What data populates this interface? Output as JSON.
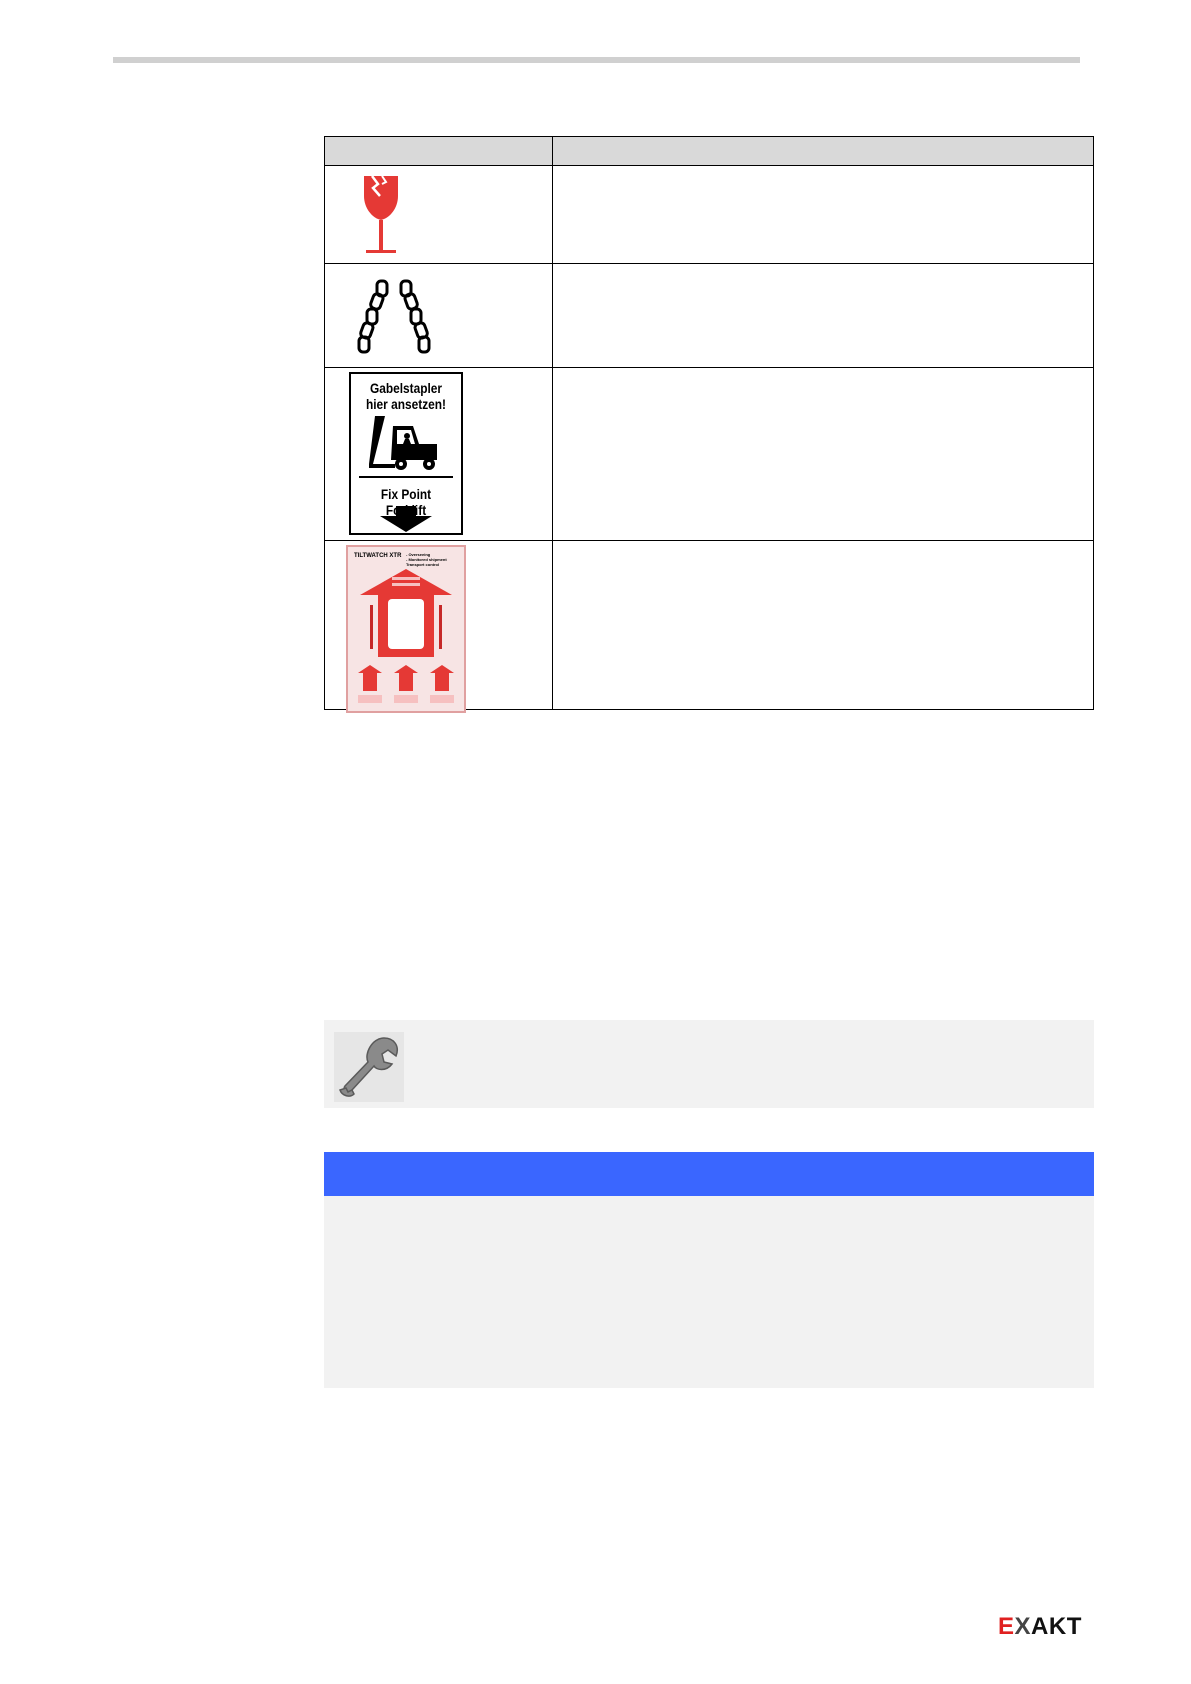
{
  "forklift_sign": {
    "line1": "Gabelstapler",
    "line2": "hier ansetzen!",
    "line3": "Fix Point Forklift"
  },
  "tiltwatch_label": {
    "brand": "TILTWATCH XTR",
    "notes": [
      "- Overseeing",
      "- Monitored shipment",
      "Transport control"
    ]
  },
  "logo": {
    "e": "E",
    "x": "X",
    "akt": "AKT"
  },
  "colors": {
    "info_header": "#3a66ff",
    "symbol_red": "#e53935",
    "box_gray": "#f2f2f2",
    "table_header": "#d9d9d9"
  },
  "icons": [
    "fragile-glass-icon",
    "lifting-chains-icon",
    "forklift-icon",
    "tiltwatch-indicator-icon",
    "wrench-icon"
  ]
}
